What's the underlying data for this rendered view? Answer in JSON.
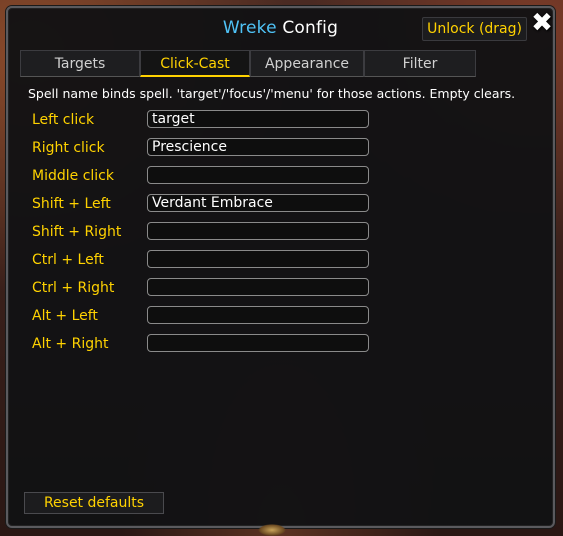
{
  "window": {
    "title_name": "Wreke",
    "title_rest": "Config",
    "unlock_label": "Unlock (drag)",
    "close_symbol": "✖"
  },
  "tabs": [
    {
      "label": "Targets",
      "active": false
    },
    {
      "label": "Click-Cast",
      "active": true
    },
    {
      "label": "Appearance",
      "active": false
    },
    {
      "label": "Filter",
      "active": false
    }
  ],
  "description": "Spell name binds spell. 'target'/'focus'/'menu' for those actions. Empty clears.",
  "bindings": [
    {
      "label": "Left click",
      "value": "target"
    },
    {
      "label": "Right click",
      "value": "Prescience"
    },
    {
      "label": "Middle click",
      "value": ""
    },
    {
      "label": "Shift + Left",
      "value": "Verdant Embrace"
    },
    {
      "label": "Shift + Right",
      "value": ""
    },
    {
      "label": "Ctrl + Left",
      "value": ""
    },
    {
      "label": "Ctrl + Right",
      "value": ""
    },
    {
      "label": "Alt + Left",
      "value": ""
    },
    {
      "label": "Alt + Right",
      "value": ""
    }
  ],
  "reset_label": "Reset defaults",
  "colors": {
    "accent_gold": "#ffd200",
    "title_blue": "#4fc3f7"
  }
}
